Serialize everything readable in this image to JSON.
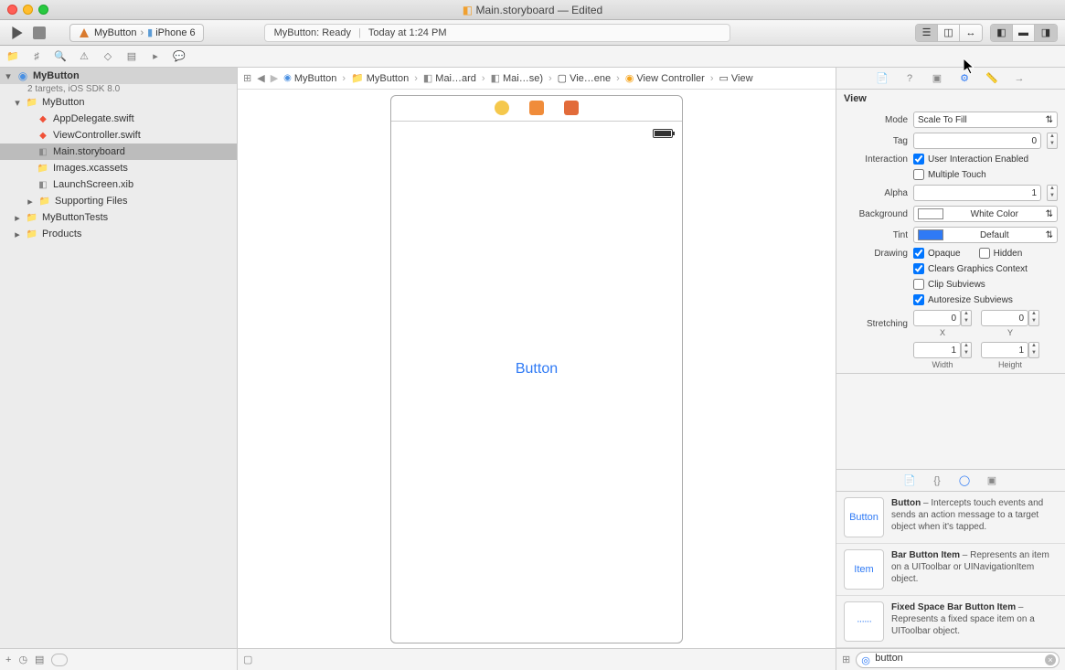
{
  "window": {
    "title": "Main.storyboard — Edited"
  },
  "toolbar": {
    "scheme_target": "MyButton",
    "scheme_device": "iPhone 6",
    "status_left": "MyButton: Ready",
    "status_right": "Today at 1:24 PM"
  },
  "navigator": {
    "project": "MyButton",
    "subtitle": "2 targets, iOS SDK 8.0",
    "tree": {
      "app_group": "MyButton",
      "files": [
        "AppDelegate.swift",
        "ViewController.swift",
        "Main.storyboard",
        "Images.xcassets",
        "LaunchScreen.xib"
      ],
      "supporting": "Supporting Files",
      "tests": "MyButtonTests",
      "products": "Products"
    }
  },
  "jumpbar": {
    "c0": "MyButton",
    "c1": "MyButton",
    "c2": "Mai…ard",
    "c3": "Mai…se)",
    "c4": "Vie…ene",
    "c5": "View Controller",
    "c6": "View"
  },
  "canvas": {
    "button_label": "Button"
  },
  "inspector": {
    "section": "View",
    "mode_label": "Mode",
    "mode_value": "Scale To Fill",
    "tag_label": "Tag",
    "tag_value": "0",
    "interaction_label": "Interaction",
    "user_interaction": "User Interaction Enabled",
    "multiple_touch": "Multiple Touch",
    "alpha_label": "Alpha",
    "alpha_value": "1",
    "background_label": "Background",
    "background_value": "White Color",
    "tint_label": "Tint",
    "tint_value": "Default",
    "drawing_label": "Drawing",
    "opaque": "Opaque",
    "hidden": "Hidden",
    "clears": "Clears Graphics Context",
    "clip": "Clip Subviews",
    "autoresize": "Autoresize Subviews",
    "stretching_label": "Stretching",
    "x": "0",
    "y": "0",
    "w": "1",
    "h": "1",
    "xl": "X",
    "yl": "Y",
    "wl": "Width",
    "hl": "Height"
  },
  "library": {
    "items": [
      {
        "thumb": "Button",
        "title": "Button",
        "desc": " – Intercepts touch events and sends an action message to a target object when it's tapped."
      },
      {
        "thumb": "Item",
        "title": "Bar Button Item",
        "desc": " – Represents an item on a UIToolbar or UINavigationItem object."
      },
      {
        "thumb": "······",
        "title": "Fixed Space Bar Button Item",
        "desc": " – Represents a fixed space item on a UIToolbar object."
      }
    ],
    "search": "button"
  }
}
